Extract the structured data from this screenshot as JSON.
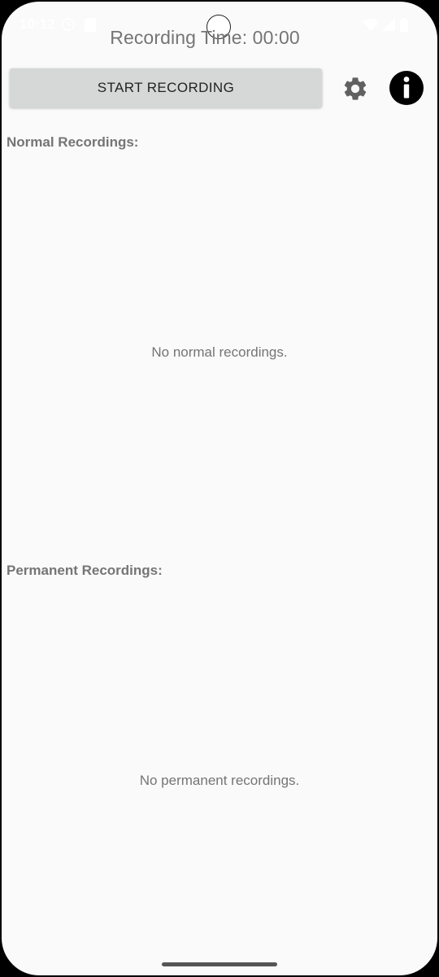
{
  "status_bar": {
    "time": "10:12"
  },
  "header": {
    "recording_time": "Recording Time: 00:00"
  },
  "toolbar": {
    "start_label": "START RECORDING",
    "settings_icon": "gear-icon",
    "info_icon": "info-icon"
  },
  "normal_section": {
    "title": "Normal Recordings:",
    "empty_message": "No normal recordings."
  },
  "permanent_section": {
    "title": "Permanent Recordings:",
    "empty_message": "No permanent recordings."
  },
  "colors": {
    "background": "#fafafa",
    "button_bg": "#d6d7d7",
    "text_gray": "#757575"
  }
}
